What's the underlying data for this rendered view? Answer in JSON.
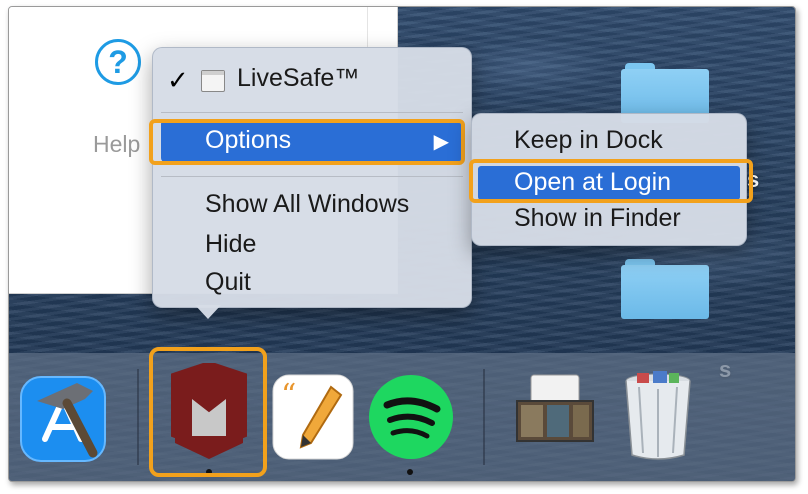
{
  "background_window": {
    "help_label": "Help"
  },
  "desktop_fragments": [
    "s",
    "s"
  ],
  "context_menu": {
    "app_name": "LiveSafe™",
    "options_label": "Options",
    "options_arrow": "▶",
    "show_all_windows": "Show All Windows",
    "hide": "Hide",
    "quit": "Quit",
    "check_mark": "✓"
  },
  "options_submenu": {
    "items": [
      "Keep in Dock",
      "Open at Login",
      "Show in Finder"
    ],
    "highlighted": "Open at Login"
  },
  "dock": {
    "apps": [
      "xcode-icon",
      "mcafee-livesafe-icon",
      "pages-icon",
      "spotify-icon",
      "preview-icon",
      "trash-icon"
    ],
    "running": [
      "mcafee-livesafe-icon",
      "spotify-icon"
    ]
  },
  "colors": {
    "highlight": "#2a6ed6",
    "annotation_outline": "#f2a11c",
    "help_blue": "#1e9be4",
    "mcafee_red": "#7a1c1c",
    "spotify_green": "#1ed760"
  }
}
